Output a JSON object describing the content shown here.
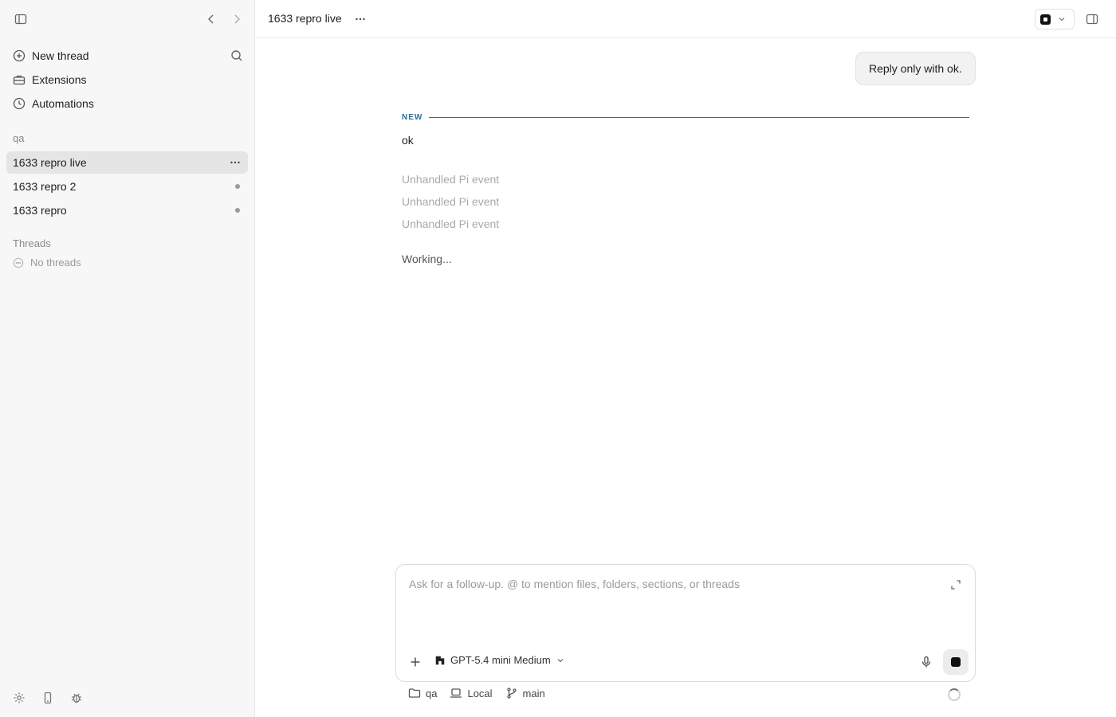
{
  "sidebar": {
    "nav": [
      {
        "label": "New thread",
        "icon": "plus-circle-icon"
      },
      {
        "label": "Extensions",
        "icon": "toolbox-icon"
      },
      {
        "label": "Automations",
        "icon": "clock-icon"
      }
    ],
    "project_label": "qa",
    "threads": [
      {
        "label": "1633 repro live",
        "active": true
      },
      {
        "label": "1633 repro 2",
        "active": false
      },
      {
        "label": "1633 repro",
        "active": false
      }
    ],
    "threads_section_label": "Threads",
    "no_threads_label": "No threads"
  },
  "header": {
    "title": "1633 repro live"
  },
  "conversation": {
    "user_message": "Reply only with ok.",
    "new_label": "NEW",
    "assistant_reply": "ok",
    "events": [
      "Unhandled Pi event",
      "Unhandled Pi event",
      "Unhandled Pi event"
    ],
    "status": "Working..."
  },
  "composer": {
    "placeholder": "Ask for a follow-up. @ to mention files, folders, sections, or threads",
    "model_label": "GPT-5.4 mini Medium"
  },
  "footer": {
    "folder": "qa",
    "environment": "Local",
    "branch": "main"
  },
  "colors": {
    "accent": "#2f6b95",
    "sidebar_bg": "#f7f7f7",
    "active_item_bg": "#e5e5e5"
  }
}
